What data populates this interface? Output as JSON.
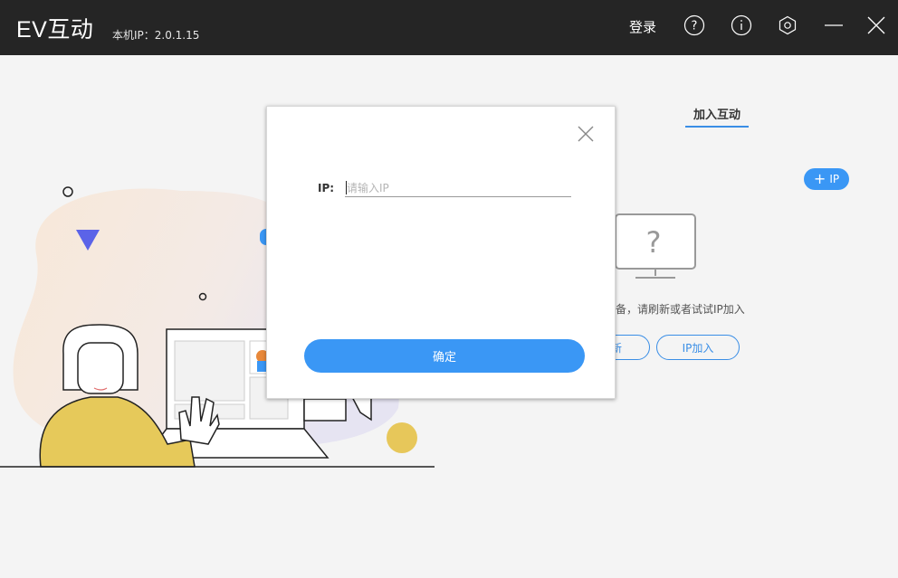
{
  "app": {
    "title": "EV互动",
    "local_ip_label": "本机IP：2.0.1.15",
    "login_label": "登录",
    "icons": [
      "help-icon",
      "info-icon",
      "settings-icon",
      "minimize-icon",
      "close-icon"
    ]
  },
  "main": {
    "tab_label": "加入互动",
    "add_ip_label": "IP",
    "hint_text": "备，请刷新或者试试IP加入",
    "refresh_label": "新",
    "ip_join_label": "IP加入"
  },
  "dialog": {
    "ip_label": "IP:",
    "ip_placeholder": "请输入IP",
    "ip_value": "",
    "confirm_label": "确定"
  },
  "colors": {
    "titlebar": "#252525",
    "accent": "#3a97f5",
    "background": "#f4f4f4"
  }
}
